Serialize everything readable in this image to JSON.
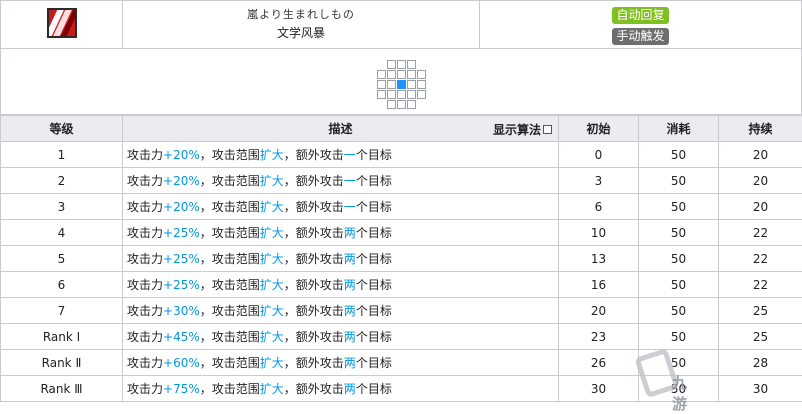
{
  "skill": {
    "name_jp": "嵐より生まれしもの",
    "name_cn": "文学风暴",
    "badges": {
      "recovery": "自动回复",
      "trigger": "手动触发"
    },
    "icon": "storm-claw-icon"
  },
  "range_grid": [
    [
      0,
      1,
      1,
      1,
      0
    ],
    [
      1,
      1,
      1,
      1,
      1
    ],
    [
      1,
      1,
      2,
      1,
      1
    ],
    [
      1,
      1,
      1,
      1,
      1
    ],
    [
      0,
      1,
      1,
      1,
      0
    ]
  ],
  "table": {
    "headers": {
      "level": "等级",
      "desc": "描述",
      "algo": "显示算法",
      "initial": "初始",
      "cost": "消耗",
      "duration": "持续"
    },
    "rows": [
      {
        "level": "1",
        "d1": "攻击力",
        "d2": "+20%",
        "d3": "，攻击范围",
        "d4": "扩大",
        "d5": "，额外攻击",
        "d6": "一",
        "d7": "个目标",
        "initial": "0",
        "cost": "50",
        "duration": "20"
      },
      {
        "level": "2",
        "d1": "攻击力",
        "d2": "+20%",
        "d3": "，攻击范围",
        "d4": "扩大",
        "d5": "，额外攻击",
        "d6": "一",
        "d7": "个目标",
        "initial": "3",
        "cost": "50",
        "duration": "20"
      },
      {
        "level": "3",
        "d1": "攻击力",
        "d2": "+20%",
        "d3": "，攻击范围",
        "d4": "扩大",
        "d5": "，额外攻击",
        "d6": "一",
        "d7": "个目标",
        "initial": "6",
        "cost": "50",
        "duration": "20"
      },
      {
        "level": "4",
        "d1": "攻击力",
        "d2": "+25%",
        "d3": "，攻击范围",
        "d4": "扩大",
        "d5": "，额外攻击",
        "d6": "两",
        "d7": "个目标",
        "initial": "10",
        "cost": "50",
        "duration": "22"
      },
      {
        "level": "5",
        "d1": "攻击力",
        "d2": "+25%",
        "d3": "，攻击范围",
        "d4": "扩大",
        "d5": "，额外攻击",
        "d6": "两",
        "d7": "个目标",
        "initial": "13",
        "cost": "50",
        "duration": "22"
      },
      {
        "level": "6",
        "d1": "攻击力",
        "d2": "+25%",
        "d3": "，攻击范围",
        "d4": "扩大",
        "d5": "，额外攻击",
        "d6": "两",
        "d7": "个目标",
        "initial": "16",
        "cost": "50",
        "duration": "22"
      },
      {
        "level": "7",
        "d1": "攻击力",
        "d2": "+30%",
        "d3": "，攻击范围",
        "d4": "扩大",
        "d5": "，额外攻击",
        "d6": "两",
        "d7": "个目标",
        "initial": "20",
        "cost": "50",
        "duration": "25"
      },
      {
        "level": "Rank Ⅰ",
        "d1": "攻击力",
        "d2": "+45%",
        "d3": "，攻击范围",
        "d4": "扩大",
        "d5": "，额外攻击",
        "d6": "两",
        "d7": "个目标",
        "initial": "23",
        "cost": "50",
        "duration": "25"
      },
      {
        "level": "Rank Ⅱ",
        "d1": "攻击力",
        "d2": "+60%",
        "d3": "，攻击范围",
        "d4": "扩大",
        "d5": "，额外攻击",
        "d6": "两",
        "d7": "个目标",
        "initial": "26",
        "cost": "50",
        "duration": "28"
      },
      {
        "level": "Rank Ⅲ",
        "d1": "攻击力",
        "d2": "+75%",
        "d3": "，攻击范围",
        "d4": "扩大",
        "d5": "，额外攻击",
        "d6": "两",
        "d7": "个目标",
        "initial": "30",
        "cost": "50",
        "duration": "30"
      }
    ]
  },
  "colors": {
    "highlight": "#0098dc",
    "auto_badge": "#7fbf1f",
    "manual_badge": "#6e6e6e",
    "range_center": "#1e90ff",
    "header_bg": "#eaecf0"
  },
  "watermark": {
    "icon": "watermark-logo-icon",
    "text": "九游"
  }
}
